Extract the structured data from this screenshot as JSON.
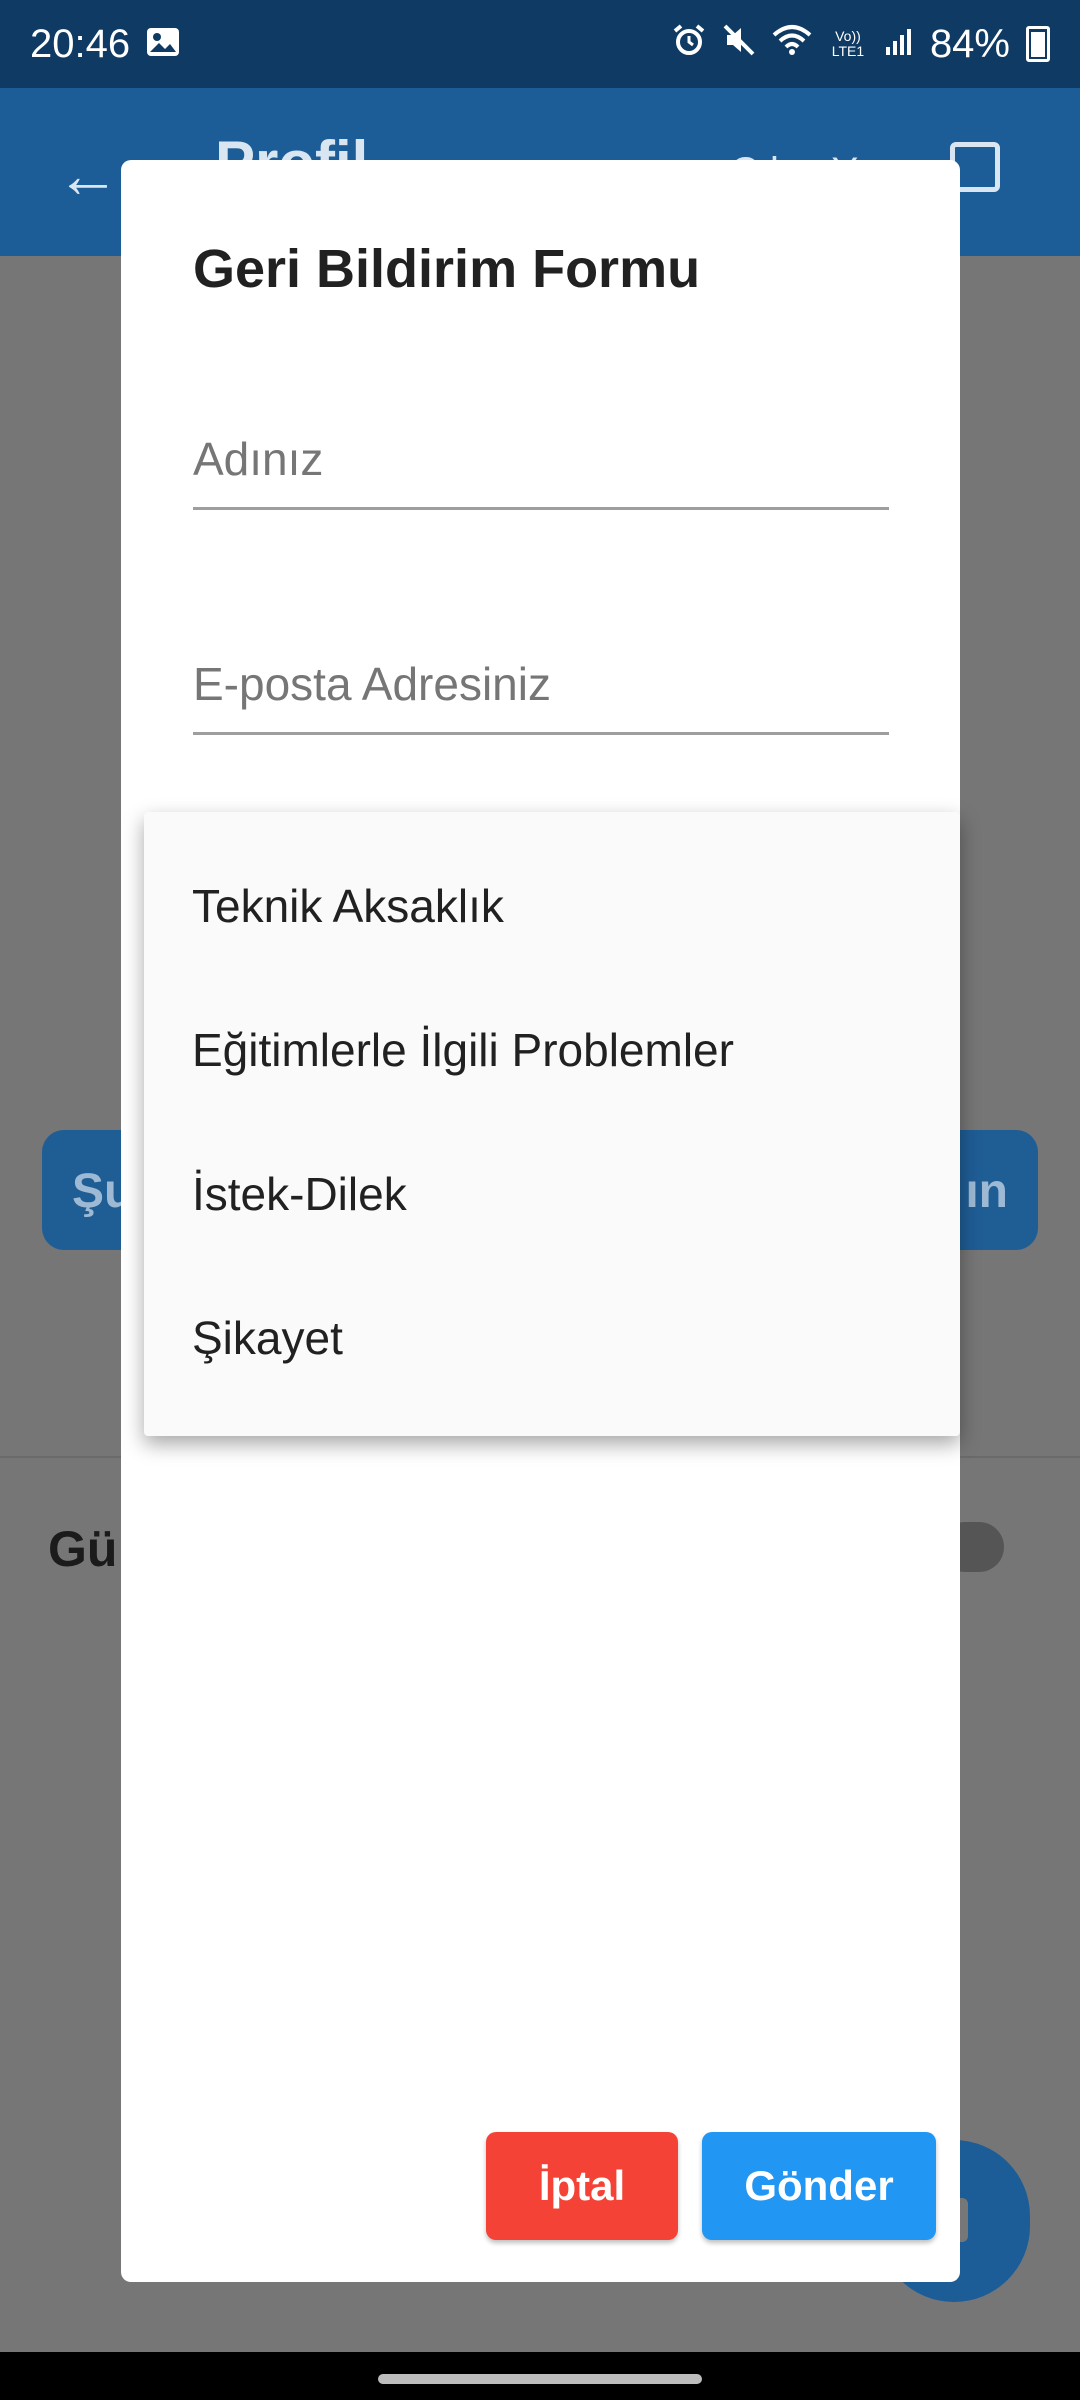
{
  "status_bar": {
    "time": "20:46",
    "left_icons": [
      "image-icon"
    ],
    "right_icons": [
      "alarm-icon",
      "mute-icon",
      "wifi-icon",
      "volte-icon",
      "signal-icon"
    ],
    "volte_label": "Vo)) LTE1",
    "battery": "84%"
  },
  "app_bar": {
    "title_partial": "Profil",
    "action_partial": "Çıkış Yap"
  },
  "background": {
    "button_left_partial": "Şu",
    "button_right_partial": "ın",
    "label_partial": "Gü"
  },
  "dialog": {
    "title": "Geri Bildirim Formu",
    "name_placeholder": "Adınız",
    "email_placeholder": "E-posta Adresiniz",
    "cancel_label": "İptal",
    "send_label": "Gönder"
  },
  "dropdown": {
    "options": [
      "Teknik Aksaklık",
      "Eğitimlerle İlgili Problemler",
      "İstek-Dilek",
      "Şikayet"
    ]
  },
  "colors": {
    "app_bar": "#1c5d98",
    "status_bar": "#0e3a63",
    "cancel_button": "#f44336",
    "send_button": "#2196f3"
  }
}
